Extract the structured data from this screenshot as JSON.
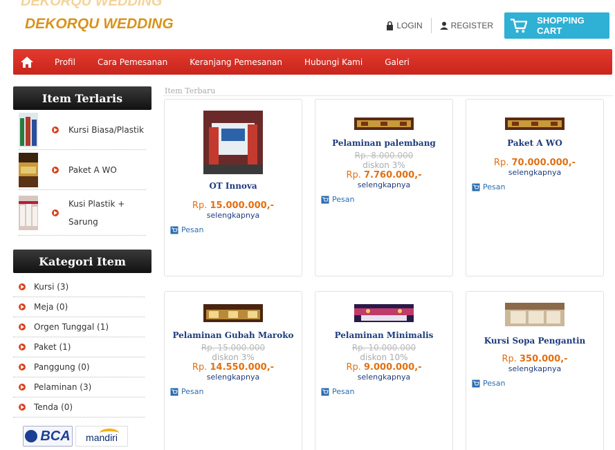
{
  "header": {
    "brand": "DEKORQU WEDDING",
    "login_label": "LOGIN",
    "register_label": "REGISTER",
    "cart_label": "SHOPPING CART"
  },
  "nav": {
    "items": [
      "Profil",
      "Cara Pemesanan",
      "Keranjang Pemesanan",
      "Hubungi Kami",
      "Galeri"
    ]
  },
  "sidebar": {
    "best_title": "Item Terlaris",
    "best_items": [
      {
        "label_lines": [
          "Kursi Biasa/Plastik"
        ]
      },
      {
        "label_lines": [
          "Paket A WO"
        ]
      },
      {
        "label_lines": [
          "Kusi Plastik +",
          "Sarung"
        ]
      }
    ],
    "category_title": "Kategori Item",
    "categories": [
      {
        "label": "Kursi (3)"
      },
      {
        "label": "Meja (0)"
      },
      {
        "label": "Orgen Tunggal (1)"
      },
      {
        "label": "Paket (1)"
      },
      {
        "label": "Panggung (0)"
      },
      {
        "label": "Pelaminan (3)"
      },
      {
        "label": "Tenda (0)"
      }
    ],
    "banks": {
      "bca": "BCA",
      "mandiri": "mandiri"
    }
  },
  "content": {
    "heading": "Item Terbaru",
    "products": [
      {
        "name": "OT Innova",
        "old_price": "",
        "discount": "",
        "price_prefix": "Rp. ",
        "price": "15.000.000",
        "price_suffix": ",-",
        "more": "selengkapnya",
        "order": "Pesan"
      },
      {
        "name": "Pelaminan palembang",
        "old_price": "Rp. 8.000.000",
        "discount": "diskon 3%",
        "price_prefix": "Rp. ",
        "price": "7.760.000",
        "price_suffix": ",-",
        "more": "selengkapnya",
        "order": "Pesan"
      },
      {
        "name": "Paket A WO",
        "old_price": "",
        "discount": "",
        "price_prefix": "Rp. ",
        "price": "70.000.000",
        "price_suffix": ",-",
        "more": "selengkapnya",
        "order": "Pesan"
      },
      {
        "name": "Pelaminan Gubah Maroko",
        "old_price": "Rp. 15.000.000",
        "discount": "diskon 3%",
        "price_prefix": "Rp. ",
        "price": "14.550.000",
        "price_suffix": ",-",
        "more": "selengkapnya",
        "order": "Pesan"
      },
      {
        "name": "Pelaminan Minimalis",
        "old_price": "Rp. 10.000.000",
        "discount": "diskon 10%",
        "price_prefix": "Rp. ",
        "price": "9.000.000",
        "price_suffix": ",-",
        "more": "selengkapnya",
        "order": "Pesan"
      },
      {
        "name": "Kursi Sopa Pengantin",
        "old_price": "",
        "discount": "",
        "price_prefix": "Rp. ",
        "price": "350.000",
        "price_suffix": ",-",
        "more": "selengkapnya",
        "order": "Pesan"
      }
    ]
  },
  "colors": {
    "brand": "#d9921a",
    "nav_red": "#d32f24",
    "cart_blue": "#2fb0d5",
    "price_orange": "#e27012",
    "link_navy": "#1e3b7c"
  }
}
